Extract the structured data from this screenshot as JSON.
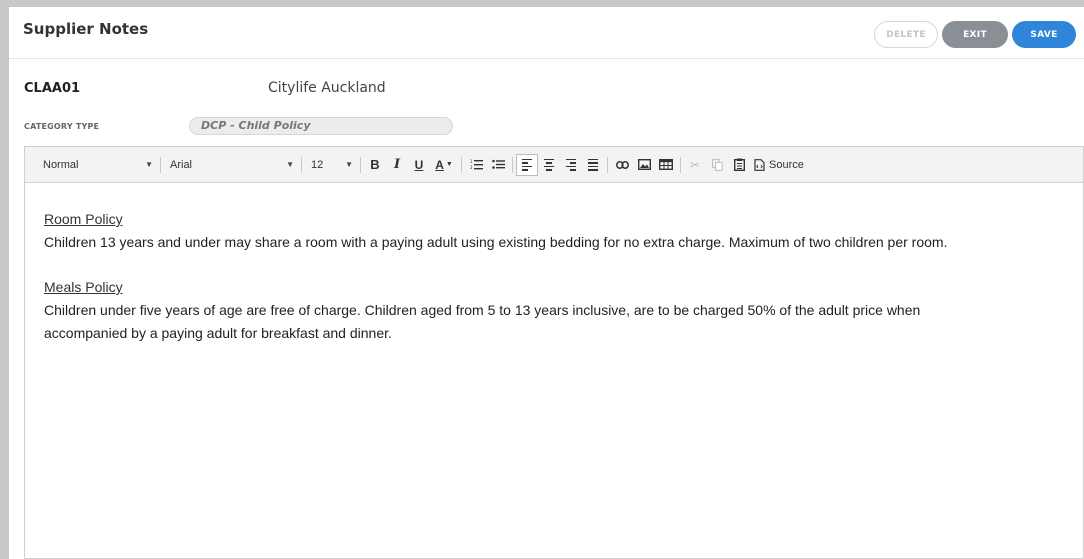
{
  "header": {
    "title": "Supplier Notes",
    "delete_label": "DELETE",
    "exit_label": "EXIT",
    "save_label": "SAVE"
  },
  "supplier": {
    "code": "CLAA01",
    "name": "Citylife Auckland"
  },
  "category": {
    "label": "CATEGORY TYPE",
    "value": "DCP - Child Policy"
  },
  "toolbar": {
    "format": "Normal",
    "font": "Arial",
    "size": "12",
    "text_color_label": "A",
    "source_label": "Source"
  },
  "content": {
    "room_heading": "Room Policy",
    "room_text": "Children 13 years and under may share a room with a paying adult using existing bedding for no extra charge. Maximum of two children per room.",
    "meals_heading": "Meals Policy",
    "meals_text_1": "Children under five years of age are free of charge. Children aged from 5 to 13 years inclusive, are to be charged 50% of the adult price when",
    "meals_text_2": "accompanied by a paying adult for breakfast and dinner."
  },
  "colors": {
    "save_button": "#2f86d8",
    "exit_button": "#8a8f95",
    "background": "#c8c8c8"
  },
  "icons": [
    "dropdown-arrow-icon",
    "text-color-icon",
    "numbered-list-icon",
    "bulleted-list-icon",
    "align-left-icon",
    "align-center-icon",
    "align-right-icon",
    "justify-icon",
    "link-icon",
    "image-icon",
    "table-icon",
    "cut-icon",
    "copy-icon",
    "paste-icon",
    "source-icon"
  ]
}
